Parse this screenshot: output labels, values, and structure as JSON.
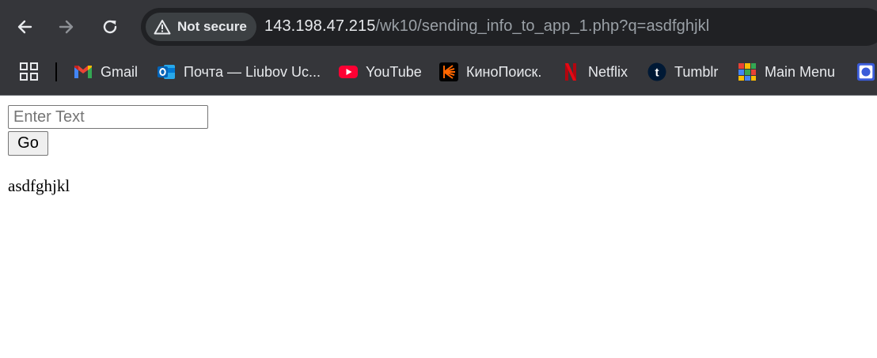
{
  "browser": {
    "security_label": "Not secure",
    "url_host": "143.198.47.215",
    "url_path": "/wk10/sending_info_to_app_1.php?q=asdfghjkl",
    "nav": {
      "back_icon": "arrow-left",
      "forward_icon": "arrow-right",
      "reload_icon": "reload"
    },
    "bookmarks": [
      {
        "label": "Gmail",
        "icon": "gmail-icon"
      },
      {
        "label": "Почта — Liubov Uc...",
        "icon": "outlook-icon"
      },
      {
        "label": "YouTube",
        "icon": "youtube-icon"
      },
      {
        "label": "КиноПоиск.",
        "icon": "kinopoisk-icon"
      },
      {
        "label": "Netflix",
        "icon": "netflix-icon"
      },
      {
        "label": "Tumblr",
        "icon": "tumblr-icon"
      },
      {
        "label": "Main Menu",
        "icon": "main-menu-icon"
      }
    ],
    "colors": {
      "toolbar": "#35363a",
      "omnibox": "#202124",
      "text": "#e8eaed",
      "dim_text": "#9aa0a6"
    }
  },
  "page": {
    "input": {
      "placeholder": "Enter Text",
      "value": ""
    },
    "go_label": "Go",
    "output_text": "asdfghjkl"
  }
}
